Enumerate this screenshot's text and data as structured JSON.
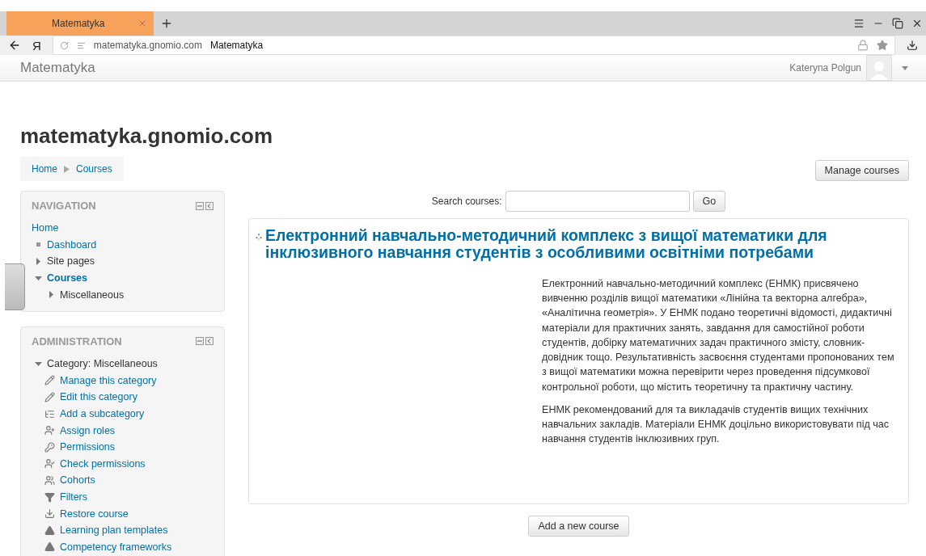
{
  "browser": {
    "logo": "Я",
    "tab": {
      "title": "Matematyka",
      "selected": true
    },
    "address": {
      "host": "matematyka.gnomio.com",
      "title": "Matematyka"
    }
  },
  "navbar": {
    "brand": "Matematyka",
    "user": "Kateryna Polgun"
  },
  "page": {
    "heading": "matematyka.gnomio.com",
    "breadcrumb": [
      "Home",
      "Courses"
    ],
    "manage_button": "Manage courses"
  },
  "navigation": {
    "title": "NAVIGATION",
    "items": [
      {
        "label": "Home",
        "kind": "root",
        "selected": false
      },
      {
        "label": "Dashboard",
        "kind": "leaf",
        "selected": false
      },
      {
        "label": "Site pages",
        "kind": "branch",
        "expanded": false,
        "selected": false
      },
      {
        "label": "Courses",
        "kind": "branch",
        "expanded": true,
        "selected": true,
        "children": [
          {
            "label": "Miscellaneous",
            "kind": "branch",
            "expanded": false,
            "selected": false
          }
        ]
      }
    ]
  },
  "administration": {
    "title": "ADMINISTRATION",
    "category": {
      "label": "Category: Miscellaneous",
      "expanded": true
    },
    "items": [
      "Manage this category",
      "Edit this category",
      "Add a subcategory",
      "Assign roles",
      "Permissions",
      "Check permissions",
      "Cohorts",
      "Filters",
      "Restore course",
      "Learning plan templates",
      "Competency frameworks"
    ]
  },
  "search": {
    "label": "Search courses:",
    "button": "Go"
  },
  "course": {
    "title": "Електронний навчально-методичний комплекс з вищої математики для інклюзивного навчання студентів з особливими освітніми потребами",
    "paragraphs": [
      "Електронний навчально-методичний комплекс (ЕНМК) присвячено вивченню розділів вищої математики «Лінійна та векторна алгебра», «Аналітична геометрія». У ЕНМК подано теоретичні відомості, дидактичні матеріали для практичних занять, завдання для самостійної роботи студентів, добірку математичних задач практичного змісту, словник-довідник тощо. Результативність засвоєння студентами пропонованих тем з вищої математики можна перевірити через проведення підсумкової контрольної роботи, що містить теоретичну та практичну частину.",
      "ЕНМК рекомендований для та викладачів студентів вищих технічних навчальних закладів. Матеріали ЕНМК доцільно використовувати під час навчання студентів інклюзивних груп."
    ]
  },
  "add_button": "Add a new course"
}
